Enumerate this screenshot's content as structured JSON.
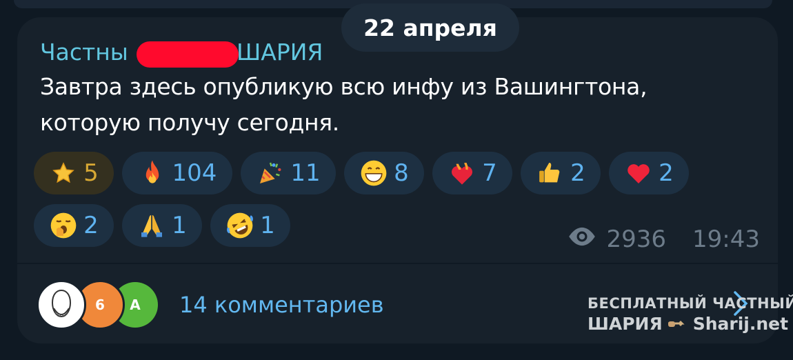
{
  "date_pill": "22 апреля",
  "channel": {
    "name_start": "Частны",
    "name_end": "ШАРИЯ"
  },
  "message": {
    "line1": "Завтра здесь опубликую всю инфу из Вашингтона,",
    "line2": "которую получу сегодня."
  },
  "reactions": [
    {
      "icon": "star-emoji",
      "count": "5"
    },
    {
      "icon": "fire-emoji",
      "count": "104"
    },
    {
      "icon": "party-popper-emoji",
      "count": "11"
    },
    {
      "icon": "grinning-face-emoji",
      "count": "8"
    },
    {
      "icon": "heart-on-fire-emoji",
      "count": "7"
    },
    {
      "icon": "thumbs-up-emoji",
      "count": "2"
    },
    {
      "icon": "red-heart-emoji",
      "count": "2"
    },
    {
      "icon": "yawning-face-emoji",
      "count": "2"
    },
    {
      "icon": "folded-hands-emoji",
      "count": "1"
    },
    {
      "icon": "rofl-emoji",
      "count": "1"
    }
  ],
  "meta": {
    "views": "2936",
    "time": "19:43"
  },
  "comments": {
    "label": "14 комментариев",
    "avatars": [
      {
        "initial": "",
        "color": "#ffffff"
      },
      {
        "initial": "6",
        "color": "#f0883a"
      },
      {
        "initial": "А",
        "color": "#56b83c"
      }
    ]
  },
  "watermark": {
    "line1": "БЕСПЛАТНЫЙ ЧАСТНЫЙ",
    "line2a": "ШАРИЯ",
    "line2b": "Sharij.net"
  },
  "colors": {
    "background": "#0f1923",
    "bubble": "#17212b",
    "accent": "#62c7e0",
    "reaction_bg": "#1d3042"
  }
}
